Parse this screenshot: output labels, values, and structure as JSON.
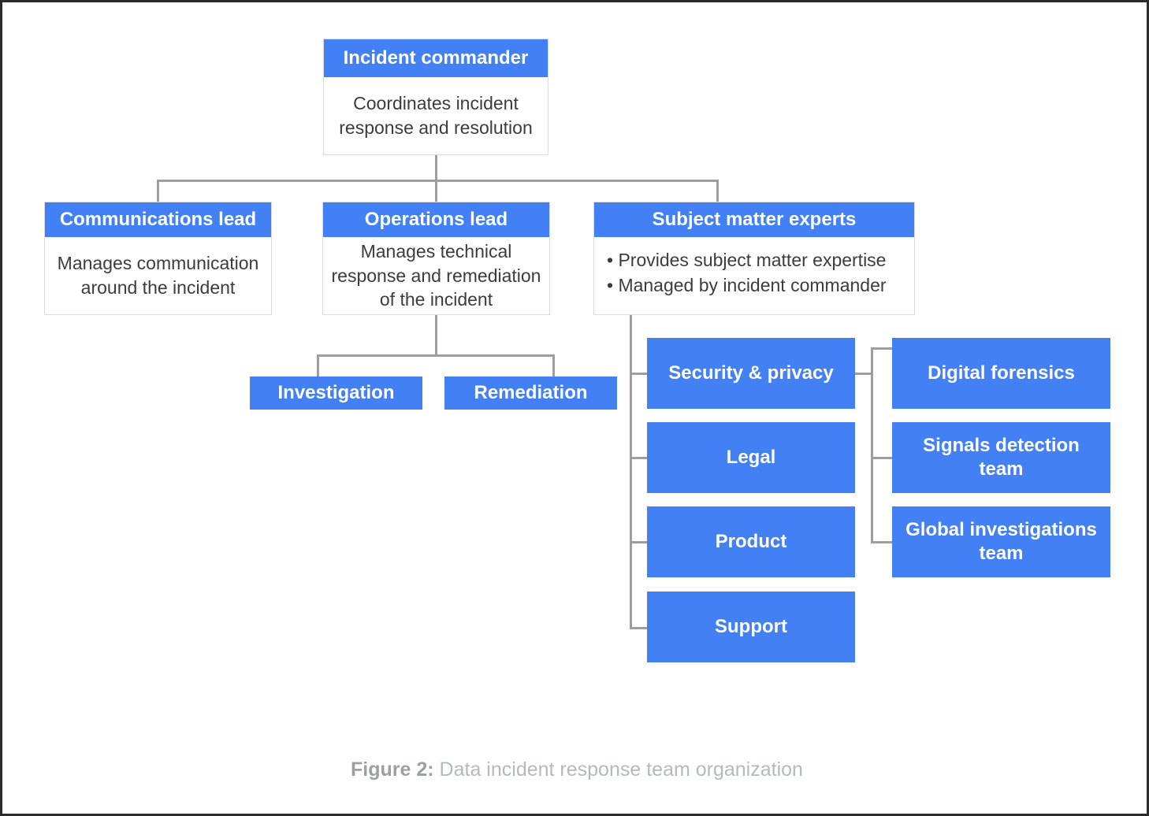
{
  "diagram": {
    "title": "Data incident response team organization",
    "caption_label": "Figure 2:",
    "caption_text": " Data incident response team organization",
    "colors": {
      "node_blue": "#4280f4",
      "node_text": "#ffffff",
      "body_text": "#3c3c3c",
      "connector": "#9e9e9e",
      "card_border": "#dcdcdc",
      "caption": "#b6b9bb",
      "frame_border": "#2b2b2b",
      "background": "#ffffff"
    },
    "nodes": {
      "incident_commander": {
        "title": "Incident commander",
        "body": "Coordinates incident response and resolution"
      },
      "communications_lead": {
        "title": "Communications lead",
        "body": "Manages communication around the incident"
      },
      "operations_lead": {
        "title": "Operations lead",
        "body": "Manages technical response and remediation of the incident"
      },
      "subject_matter_experts": {
        "title": "Subject matter experts",
        "bullet1": "• Provides subject matter expertise",
        "bullet2": "• Managed by incident commander"
      },
      "investigation": {
        "title": "Investigation"
      },
      "remediation": {
        "title": "Remediation"
      },
      "security_privacy": {
        "title": "Security & privacy"
      },
      "legal": {
        "title": "Legal"
      },
      "product": {
        "title": "Product"
      },
      "support": {
        "title": "Support"
      },
      "digital_forensics": {
        "title": "Digital forensics"
      },
      "signals_detection_team": {
        "title": "Signals detection team"
      },
      "global_investigations_team": {
        "title": "Global investigations team"
      }
    }
  },
  "chart_data": {
    "type": "diagram",
    "subtype": "org-chart",
    "title": "Data incident response team organization",
    "nodes": [
      {
        "id": "incident_commander",
        "label": "Incident commander",
        "description": "Coordinates incident response and resolution",
        "level": 0,
        "style": "card"
      },
      {
        "id": "communications_lead",
        "label": "Communications lead",
        "description": "Manages communication around the incident",
        "level": 1,
        "style": "card"
      },
      {
        "id": "operations_lead",
        "label": "Operations lead",
        "description": "Manages technical response and remediation of the incident",
        "level": 1,
        "style": "card"
      },
      {
        "id": "subject_matter_experts",
        "label": "Subject matter experts",
        "description": "• Provides subject matter expertise • Managed by incident commander",
        "level": 1,
        "style": "card"
      },
      {
        "id": "investigation",
        "label": "Investigation",
        "level": 2,
        "style": "flat"
      },
      {
        "id": "remediation",
        "label": "Remediation",
        "level": 2,
        "style": "flat"
      },
      {
        "id": "security_privacy",
        "label": "Security & privacy",
        "level": 2,
        "style": "flat"
      },
      {
        "id": "legal",
        "label": "Legal",
        "level": 2,
        "style": "flat"
      },
      {
        "id": "product",
        "label": "Product",
        "level": 2,
        "style": "flat"
      },
      {
        "id": "support",
        "label": "Support",
        "level": 2,
        "style": "flat"
      },
      {
        "id": "digital_forensics",
        "label": "Digital forensics",
        "level": 3,
        "style": "flat"
      },
      {
        "id": "signals_detection_team",
        "label": "Signals detection team",
        "level": 3,
        "style": "flat"
      },
      {
        "id": "global_investigations_team",
        "label": "Global investigations team",
        "level": 3,
        "style": "flat"
      }
    ],
    "edges": [
      {
        "from": "incident_commander",
        "to": "communications_lead"
      },
      {
        "from": "incident_commander",
        "to": "operations_lead"
      },
      {
        "from": "incident_commander",
        "to": "subject_matter_experts"
      },
      {
        "from": "operations_lead",
        "to": "investigation"
      },
      {
        "from": "operations_lead",
        "to": "remediation"
      },
      {
        "from": "subject_matter_experts",
        "to": "security_privacy"
      },
      {
        "from": "subject_matter_experts",
        "to": "legal"
      },
      {
        "from": "subject_matter_experts",
        "to": "product"
      },
      {
        "from": "subject_matter_experts",
        "to": "support"
      },
      {
        "from": "security_privacy",
        "to": "digital_forensics"
      },
      {
        "from": "security_privacy",
        "to": "signals_detection_team"
      },
      {
        "from": "security_privacy",
        "to": "global_investigations_team"
      }
    ]
  }
}
